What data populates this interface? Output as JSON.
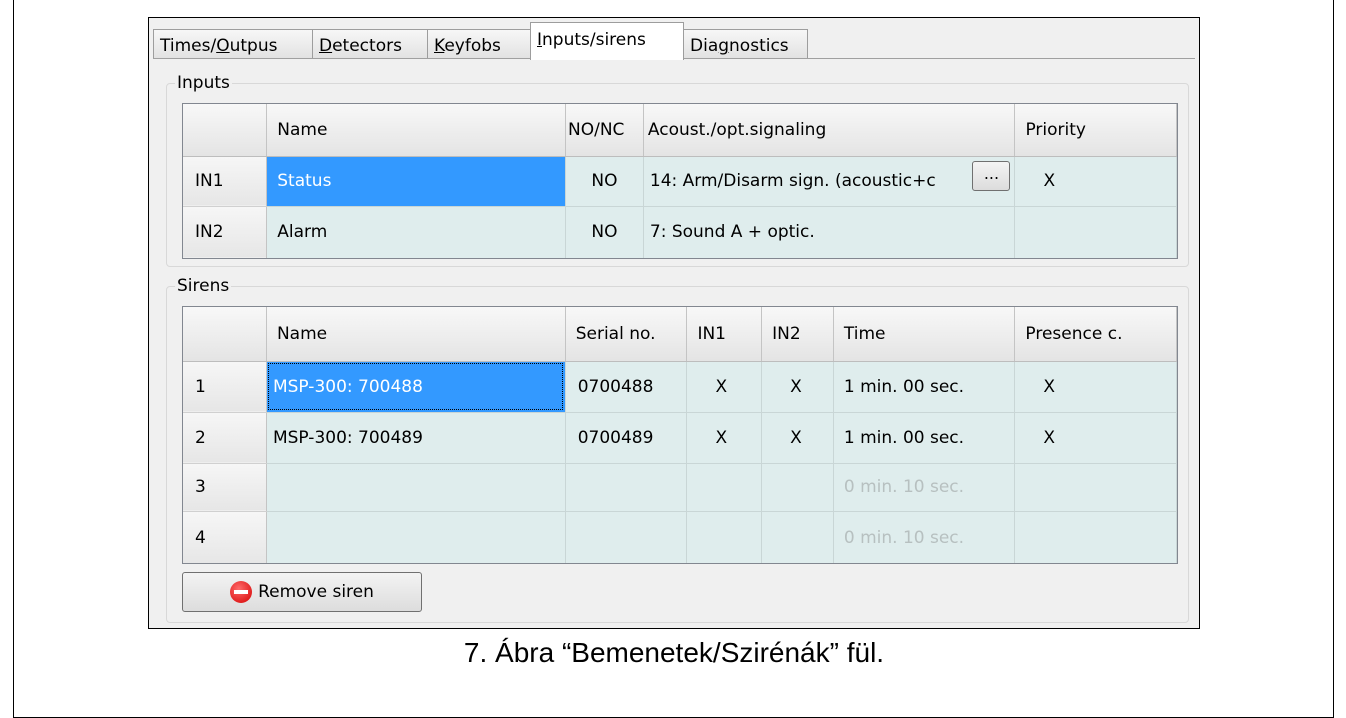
{
  "tabs": [
    {
      "label_pre": "Times/",
      "label_ul": "O",
      "label_post": "utpus"
    },
    {
      "label_pre": "",
      "label_ul": "D",
      "label_post": "etectors"
    },
    {
      "label_pre": "",
      "label_ul": "K",
      "label_post": "eyfobs"
    },
    {
      "label_pre": "",
      "label_ul": "I",
      "label_post": "nputs/sirens"
    },
    {
      "label_pre": "Dia",
      "label_ul": "g",
      "label_post": "nostics"
    }
  ],
  "active_tab": "Inputs/sirens",
  "inputs": {
    "group_label": "Inputs",
    "columns": [
      "",
      "Name",
      "NO/NC",
      "Acoust./opt.signaling",
      "Priority"
    ],
    "rows": [
      {
        "id": "IN1",
        "name": "Status",
        "nonc": "NO",
        "signaling": "14: Arm/Disarm sign. (acoustic+c",
        "priority": "X"
      },
      {
        "id": "IN2",
        "name": "Alarm",
        "nonc": "NO",
        "signaling": "7: Sound A + optic.",
        "priority": ""
      }
    ],
    "ellipsis_label": "..."
  },
  "sirens": {
    "group_label": "Sirens",
    "columns": [
      "",
      "Name",
      "Serial no.",
      "IN1",
      "IN2",
      "Time",
      "Presence c."
    ],
    "rows": [
      {
        "id": "1",
        "name": "MSP-300: 700488",
        "serial": "0700488",
        "in1": "X",
        "in2": "X",
        "time": "1 min. 00 sec.",
        "presence": "X"
      },
      {
        "id": "2",
        "name": "MSP-300: 700489",
        "serial": "0700489",
        "in1": "X",
        "in2": "X",
        "time": "1 min. 00 sec.",
        "presence": "X"
      },
      {
        "id": "3",
        "name": "",
        "serial": "",
        "in1": "",
        "in2": "",
        "time": "0 min. 10 sec.",
        "presence": ""
      },
      {
        "id": "4",
        "name": "",
        "serial": "",
        "in1": "",
        "in2": "",
        "time": "0 min. 10 sec.",
        "presence": ""
      }
    ]
  },
  "remove_button": {
    "label": "Remove siren",
    "icon": "no-entry-icon"
  },
  "caption": "7. Ábra “Bemenetek/Szirénák” fül.",
  "colors": {
    "selection": "#3399ff",
    "grid_bg": "#dfeded",
    "window_bg": "#f0f0f0"
  }
}
